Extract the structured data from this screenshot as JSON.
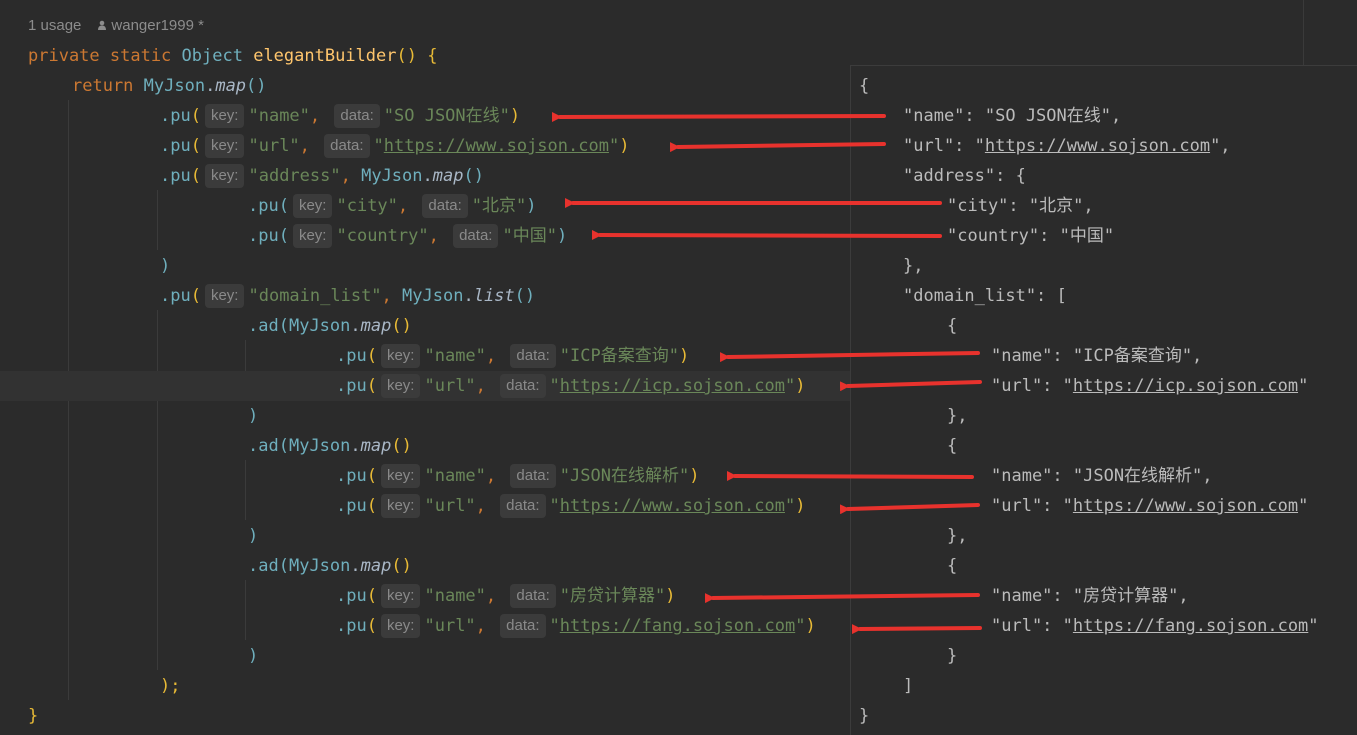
{
  "meta": {
    "usage": "1 usage",
    "author": "wanger1999 *"
  },
  "code": {
    "l1": {
      "modifiers": "private static ",
      "type": "Object",
      "method": "elegantBuilder",
      "parens": "()",
      "brace": " {"
    },
    "l2": {
      "kw": "return ",
      "cls": "MyJson",
      "dot": ".",
      "fn": "map",
      "parens": "()"
    },
    "l3": {
      "call": ".pu",
      "open": "(",
      "hint1": "key:",
      "key": "\"name\"",
      "comma": ", ",
      "hint2": "data:",
      "val": "\"SO JSON在线\"",
      "close": ")"
    },
    "l4": {
      "call": ".pu",
      "open": "(",
      "hint1": "key:",
      "key": "\"url\"",
      "comma": ", ",
      "hint2": "data:",
      "q1": "\"",
      "val": "https://www.sojson.com",
      "q2": "\"",
      "close": ")"
    },
    "l5": {
      "call": ".pu",
      "open": "(",
      "hint1": "key:",
      "key": "\"address\"",
      "comma": ", ",
      "cls": "MyJson",
      "dot": ".",
      "fn": "map",
      "parens": "()"
    },
    "l6": {
      "call": ".pu",
      "open": "(",
      "hint1": "key:",
      "key": "\"city\"",
      "comma": ", ",
      "hint2": "data:",
      "val": "\"北京\"",
      "close": ")"
    },
    "l7": {
      "call": ".pu",
      "open": "(",
      "hint1": "key:",
      "key": "\"country\"",
      "comma": ", ",
      "hint2": "data:",
      "val": "\"中国\"",
      "close": ")"
    },
    "l8": {
      "close": ")"
    },
    "l9": {
      "call": ".pu",
      "open": "(",
      "hint1": "key:",
      "key": "\"domain_list\"",
      "comma": ", ",
      "cls": "MyJson",
      "dot": ".",
      "fn": "list",
      "parens": "()"
    },
    "l10": {
      "call": ".ad",
      "open": "(",
      "cls": "MyJson",
      "dot": ".",
      "fn": "map",
      "parens": "()"
    },
    "l11": {
      "call": ".pu",
      "open": "(",
      "hint1": "key:",
      "key": "\"name\"",
      "comma": ", ",
      "hint2": "data:",
      "val": "\"ICP备案查询\"",
      "close": ")"
    },
    "l12": {
      "call": ".pu",
      "open": "(",
      "hint1": "key:",
      "key": "\"url\"",
      "comma": ", ",
      "hint2": "data:",
      "q1": "\"",
      "val": "https://icp.sojson.com",
      "q2": "\"",
      "close": ")"
    },
    "l13": {
      "close": ")"
    },
    "l14": {
      "call": ".ad",
      "open": "(",
      "cls": "MyJson",
      "dot": ".",
      "fn": "map",
      "parens": "()"
    },
    "l15": {
      "call": ".pu",
      "open": "(",
      "hint1": "key:",
      "key": "\"name\"",
      "comma": ", ",
      "hint2": "data:",
      "val": "\"JSON在线解析\"",
      "close": ")"
    },
    "l16": {
      "call": ".pu",
      "open": "(",
      "hint1": "key:",
      "key": "\"url\"",
      "comma": ", ",
      "hint2": "data:",
      "q1": "\"",
      "val": "https://www.sojson.com",
      "q2": "\"",
      "close": ")"
    },
    "l17": {
      "close": ")"
    },
    "l18": {
      "call": ".ad",
      "open": "(",
      "cls": "MyJson",
      "dot": ".",
      "fn": "map",
      "parens": "()"
    },
    "l19": {
      "call": ".pu",
      "open": "(",
      "hint1": "key:",
      "key": "\"name\"",
      "comma": ", ",
      "hint2": "data:",
      "val": "\"房贷计算器\"",
      "close": ")"
    },
    "l20": {
      "call": ".pu",
      "open": "(",
      "hint1": "key:",
      "key": "\"url\"",
      "comma": ", ",
      "hint2": "data:",
      "q1": "\"",
      "val": "https://fang.sojson.com",
      "q2": "\"",
      "close": ")"
    },
    "l21": {
      "close": ")"
    },
    "l22": {
      "close": ");"
    },
    "l23": {
      "close": "}"
    }
  },
  "json_panel": {
    "p1": "{",
    "p2": {
      "pre": "\"name\": \"SO JSON在线\","
    },
    "p3": {
      "pre": "\"url\": \"",
      "link": "https://www.sojson.com",
      "post": "\","
    },
    "p4": "\"address\": {",
    "p5": "\"city\": \"北京\",",
    "p6": "\"country\": \"中国\"",
    "p7": "},",
    "p8": "\"domain_list\": [",
    "p9": "{",
    "p10": "\"name\": \"ICP备案查询\",",
    "p11": {
      "pre": "\"url\": \"",
      "link": "https://icp.sojson.com",
      "post": "\""
    },
    "p12": "},",
    "p13": "{",
    "p14": "\"name\": \"JSON在线解析\",",
    "p15": {
      "pre": "\"url\": \"",
      "link": "https://www.sojson.com",
      "post": "\""
    },
    "p16": "},",
    "p17": "{",
    "p18": "\"name\": \"房贷计算器\",",
    "p19": {
      "pre": "\"url\": \"",
      "link": "https://fang.sojson.com",
      "post": "\""
    },
    "p20": "}",
    "p21": "]",
    "p22": "}"
  },
  "colors": {
    "arrow": "#e8322d",
    "background": "#2b2b2b",
    "string": "#6a8759",
    "keyword": "#cc7832"
  }
}
